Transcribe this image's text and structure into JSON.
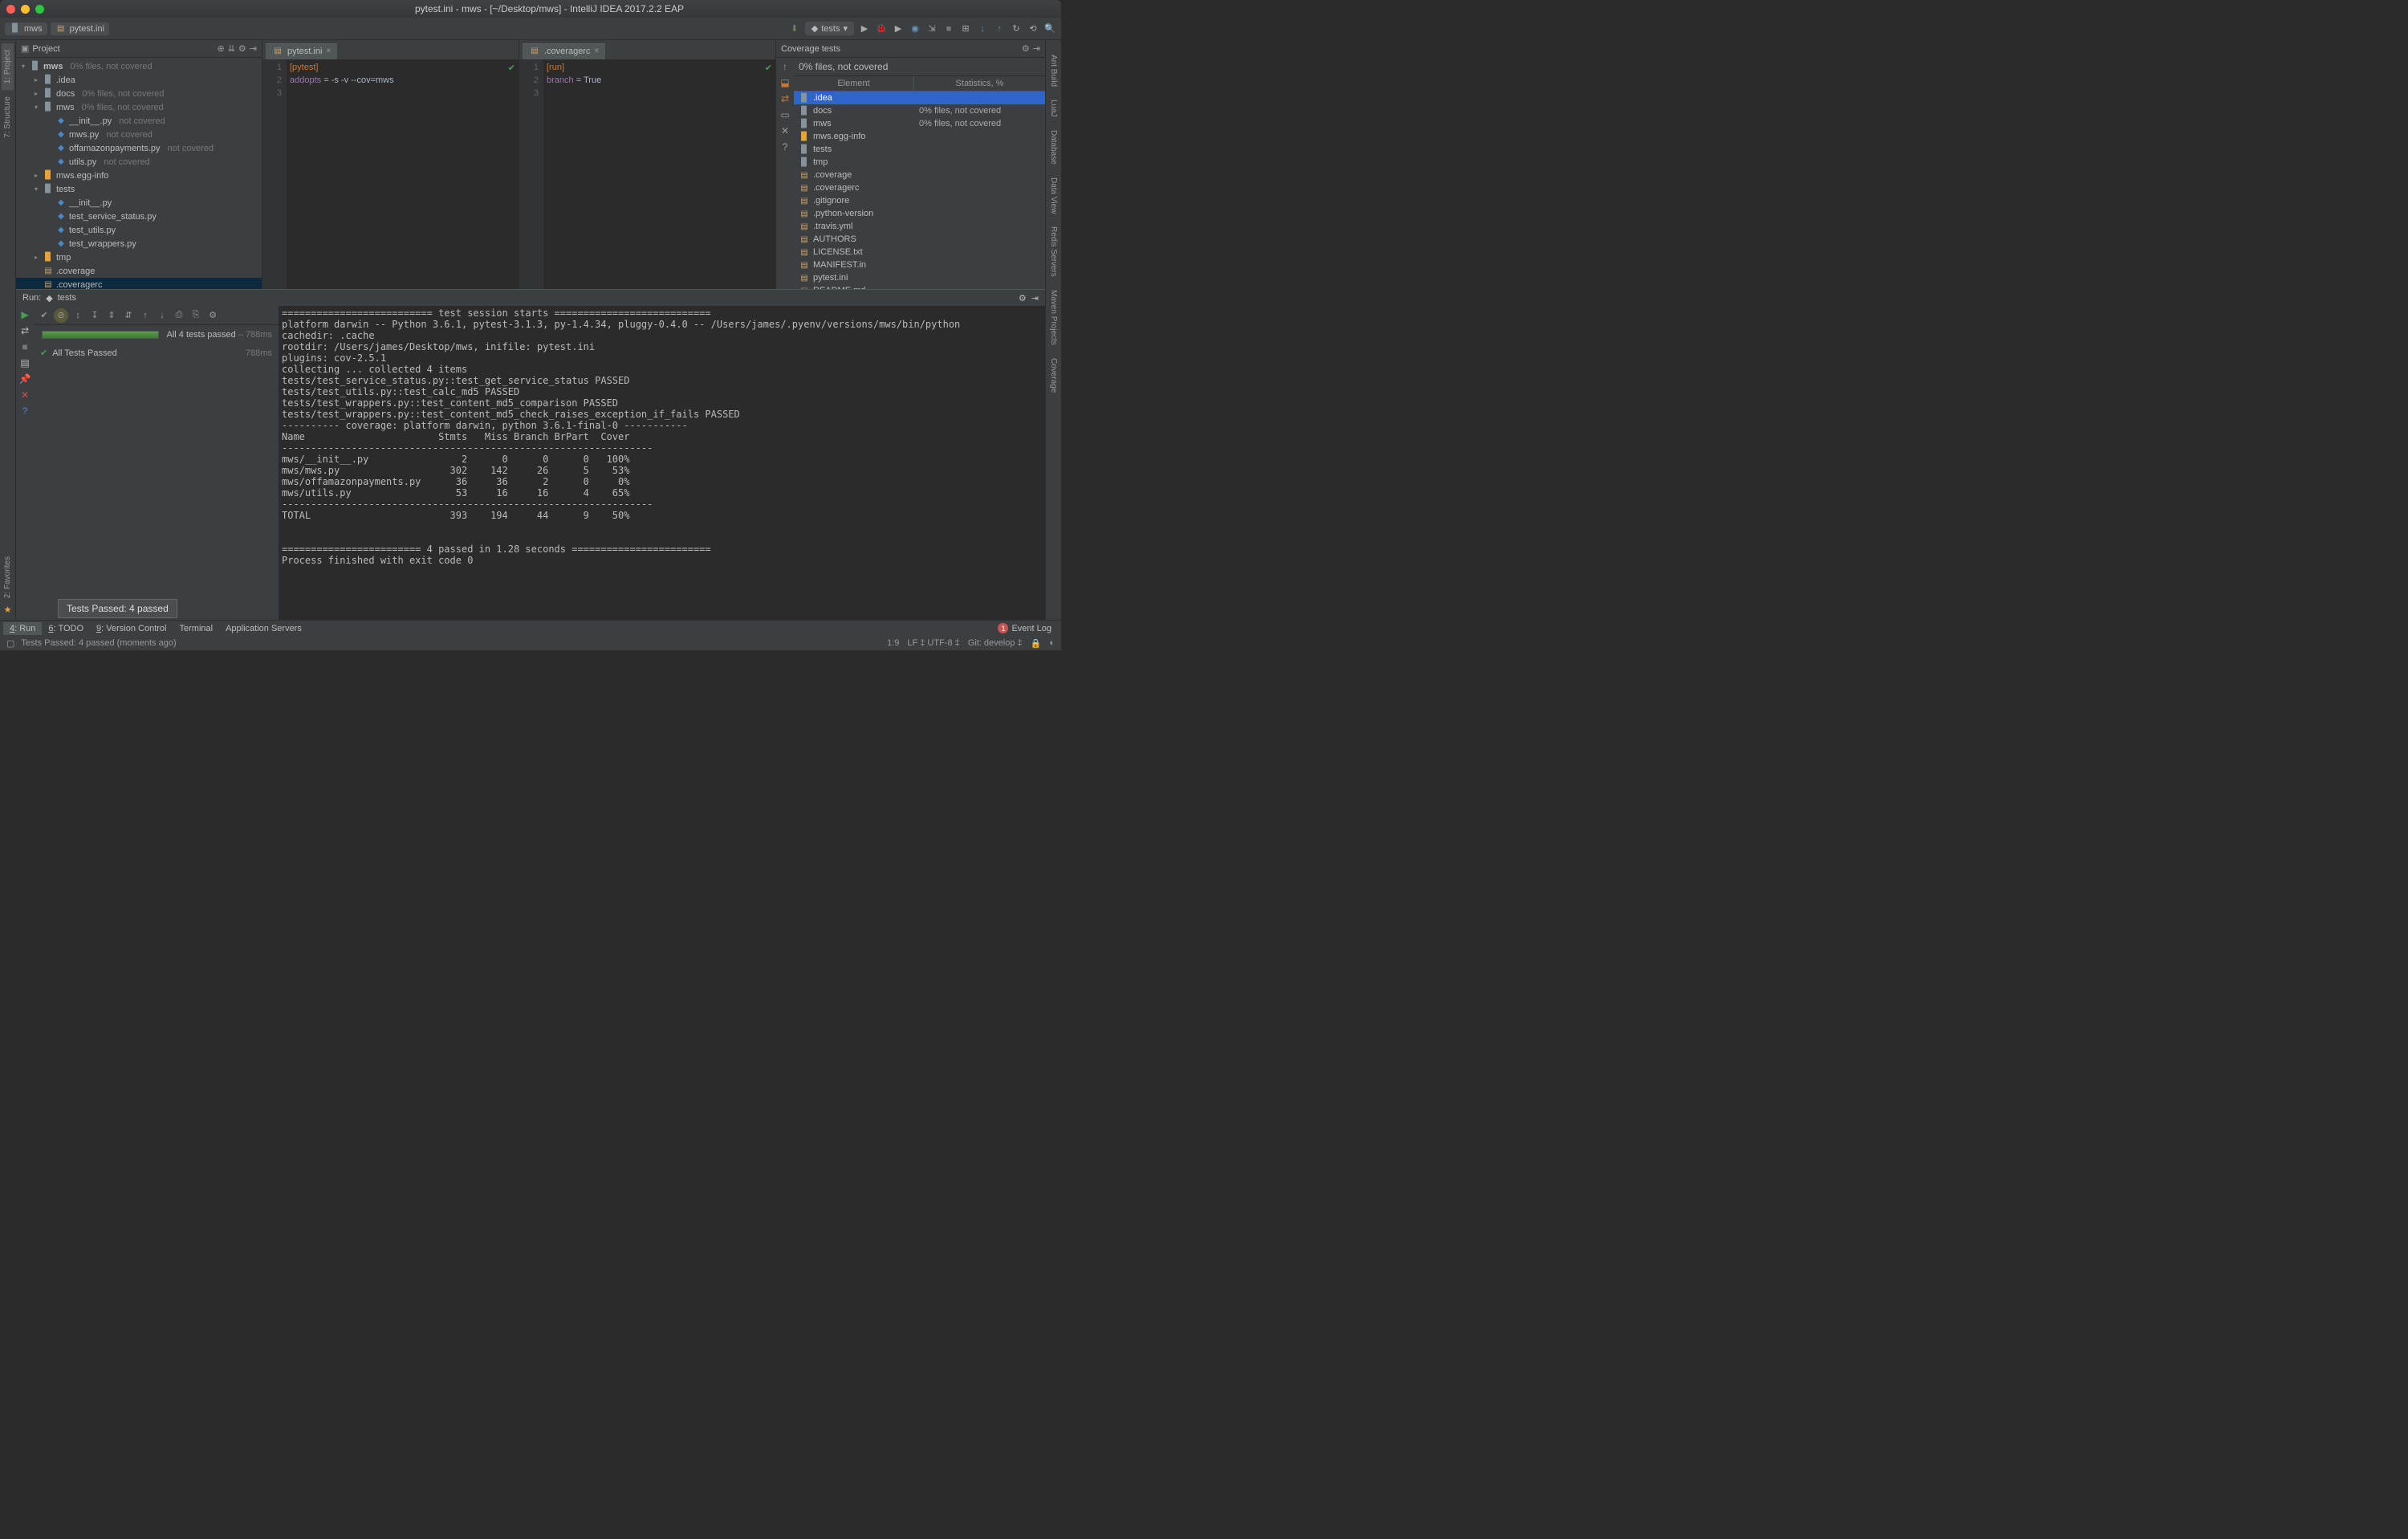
{
  "window_title": "pytest.ini - mws - [~/Desktop/mws] - IntelliJ IDEA 2017.2.2 EAP",
  "breadcrumbs": [
    "mws",
    "pytest.ini"
  ],
  "run_config": "tests",
  "project_panel": {
    "title": "Project",
    "root": {
      "name": "mws",
      "stat": "0% files, not covered"
    },
    "tree": [
      {
        "d": 1,
        "k": "folder",
        "name": ".idea",
        "tw": "▸"
      },
      {
        "d": 1,
        "k": "folder",
        "name": "docs",
        "stat": "0% files, not covered",
        "tw": "▸"
      },
      {
        "d": 1,
        "k": "folder",
        "name": "mws",
        "stat": "0% files, not covered",
        "tw": "▾"
      },
      {
        "d": 2,
        "k": "py",
        "name": "__init__.py",
        "stat": "not covered"
      },
      {
        "d": 2,
        "k": "py",
        "name": "mws.py",
        "stat": "not covered"
      },
      {
        "d": 2,
        "k": "py",
        "name": "offamazonpayments.py",
        "stat": "not covered"
      },
      {
        "d": 2,
        "k": "py",
        "name": "utils.py",
        "stat": "not covered"
      },
      {
        "d": 1,
        "k": "folder-o",
        "name": "mws.egg-info",
        "tw": "▸"
      },
      {
        "d": 1,
        "k": "folder",
        "name": "tests",
        "tw": "▾"
      },
      {
        "d": 2,
        "k": "py",
        "name": "__init__.py"
      },
      {
        "d": 2,
        "k": "py",
        "name": "test_service_status.py"
      },
      {
        "d": 2,
        "k": "py",
        "name": "test_utils.py"
      },
      {
        "d": 2,
        "k": "py",
        "name": "test_wrappers.py"
      },
      {
        "d": 1,
        "k": "folder-o",
        "name": "tmp",
        "tw": "▸"
      },
      {
        "d": 1,
        "k": "file",
        "name": ".coverage"
      },
      {
        "d": 1,
        "k": "file",
        "name": ".coveragerc",
        "sel": true
      }
    ]
  },
  "editor1": {
    "tab": "pytest.ini",
    "lines": [
      {
        "seg": [
          {
            "c": "k-sec",
            "t": "[pytest]"
          }
        ]
      },
      {
        "seg": [
          {
            "c": "k-key",
            "t": "addopts"
          },
          {
            "c": "k-val",
            "t": " = "
          },
          {
            "c": "k-val",
            "t": "-s -v --cov=mws"
          }
        ]
      },
      {
        "seg": []
      }
    ]
  },
  "editor2": {
    "tab": ".coveragerc",
    "lines": [
      {
        "seg": [
          {
            "c": "k-sec",
            "t": "[run]"
          }
        ]
      },
      {
        "seg": [
          {
            "c": "k-key",
            "t": "branch"
          },
          {
            "c": "k-val",
            "t": " = "
          },
          {
            "c": "k-val",
            "t": "True"
          }
        ]
      },
      {
        "seg": []
      }
    ]
  },
  "coverage": {
    "title": "Coverage tests",
    "summary": "0% files, not covered",
    "cols": [
      "Element",
      "Statistics, %"
    ],
    "rows": [
      {
        "ico": "folder",
        "name": ".idea",
        "stat": "",
        "sel": true
      },
      {
        "ico": "folder",
        "name": "docs",
        "stat": "0% files, not covered"
      },
      {
        "ico": "folder",
        "name": "mws",
        "stat": "0% files, not covered"
      },
      {
        "ico": "folder-o",
        "name": "mws.egg-info",
        "stat": ""
      },
      {
        "ico": "folder",
        "name": "tests",
        "stat": ""
      },
      {
        "ico": "folder",
        "name": "tmp",
        "stat": ""
      },
      {
        "ico": "file",
        "name": ".coverage",
        "stat": ""
      },
      {
        "ico": "file",
        "name": ".coveragerc",
        "stat": ""
      },
      {
        "ico": "file",
        "name": ".gitignore",
        "stat": ""
      },
      {
        "ico": "file",
        "name": ".python-version",
        "stat": ""
      },
      {
        "ico": "file",
        "name": ".travis.yml",
        "stat": ""
      },
      {
        "ico": "file",
        "name": "AUTHORS",
        "stat": ""
      },
      {
        "ico": "file",
        "name": "LICENSE.txt",
        "stat": ""
      },
      {
        "ico": "file",
        "name": "MANIFEST.in",
        "stat": ""
      },
      {
        "ico": "file",
        "name": "pytest.ini",
        "stat": ""
      },
      {
        "ico": "file",
        "name": "README.md",
        "stat": ""
      }
    ]
  },
  "run": {
    "header": "Run:",
    "config": "tests",
    "status_summary": "All 4 tests passed",
    "status_time": "– 788ms",
    "tree_label": "All Tests Passed",
    "tree_time": "788ms",
    "console": "========================== test session starts ===========================\nplatform darwin -- Python 3.6.1, pytest-3.1.3, py-1.4.34, pluggy-0.4.0 -- /Users/james/.pyenv/versions/mws/bin/python\ncachedir: .cache\nrootdir: /Users/james/Desktop/mws, inifile: pytest.ini\nplugins: cov-2.5.1\ncollecting ... collected 4 items\ntests/test_service_status.py::test_get_service_status PASSED\ntests/test_utils.py::test_calc_md5 PASSED\ntests/test_wrappers.py::test_content_md5_comparison PASSED\ntests/test_wrappers.py::test_content_md5_check_raises_exception_if_fails PASSED\n---------- coverage: platform darwin, python 3.6.1-final-0 -----------\nName                       Stmts   Miss Branch BrPart  Cover\n----------------------------------------------------------------\nmws/__init__.py                2      0      0      0   100%\nmws/mws.py                   302    142     26      5    53%\nmws/offamazonpayments.py      36     36      2      0     0%\nmws/utils.py                  53     16     16      4    65%\n----------------------------------------------------------------\nTOTAL                        393    194     44      9    50%\n\n\n======================== 4 passed in 1.28 seconds ========================\nProcess finished with exit code 0"
  },
  "bottom_tabs": [
    {
      "label": "4: Run",
      "u": "4",
      "act": true
    },
    {
      "label": "6: TODO",
      "u": "6"
    },
    {
      "label": "9: Version Control",
      "u": "9"
    },
    {
      "label": "Terminal"
    },
    {
      "label": "Application Servers"
    }
  ],
  "event_log": "Event Log",
  "tooltip": "Tests Passed: 4 passed",
  "status": {
    "msg": "Tests Passed: 4 passed (moments ago)",
    "pos": "1:9",
    "enc": "LF ‡   UTF-8 ‡",
    "git": "Git: develop ‡"
  },
  "left_rail": [
    "1: Project",
    "7: Structure"
  ],
  "left_rail_bottom": "2: Favorites",
  "right_rail": [
    "Ant Build",
    "LuaJ",
    "Database",
    "Data View",
    "Redis Servers",
    "Maven Projects",
    "Coverage"
  ]
}
